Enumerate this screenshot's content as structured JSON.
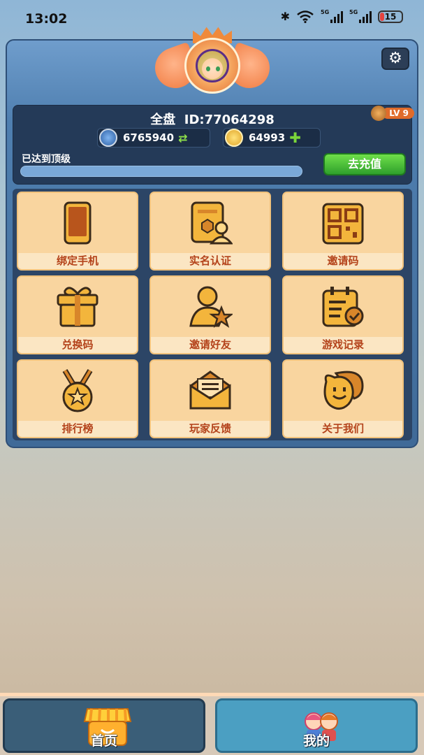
{
  "status_bar": {
    "time": "13:02",
    "battery": "15",
    "signal1": "5G",
    "signal2": "5G"
  },
  "profile": {
    "name": "全盘",
    "id_label": "ID:77064298",
    "level": "LV 9",
    "diamonds": "6765940",
    "gold": "64993",
    "level_status": "已达到顶级",
    "recharge_label": "去充值"
  },
  "menu": [
    {
      "label": "绑定手机",
      "icon": "phone-icon"
    },
    {
      "label": "实名认证",
      "icon": "id-card-icon"
    },
    {
      "label": "邀请码",
      "icon": "qr-code-icon"
    },
    {
      "label": "兑换码",
      "icon": "gift-icon"
    },
    {
      "label": "邀请好友",
      "icon": "invite-friend-icon"
    },
    {
      "label": "游戏记录",
      "icon": "calendar-record-icon"
    },
    {
      "label": "排行榜",
      "icon": "medal-icon"
    },
    {
      "label": "玩家反馈",
      "icon": "envelope-icon"
    },
    {
      "label": "关于我们",
      "icon": "chat-faces-icon"
    }
  ],
  "nav": {
    "home_label": "首页",
    "mine_label": "我的"
  },
  "colors": {
    "accent_orange": "#b4431b",
    "tile_bg": "#fbe6c3",
    "panel_blue": "#4f7fb0",
    "recharge_green": "#2fa02c"
  }
}
